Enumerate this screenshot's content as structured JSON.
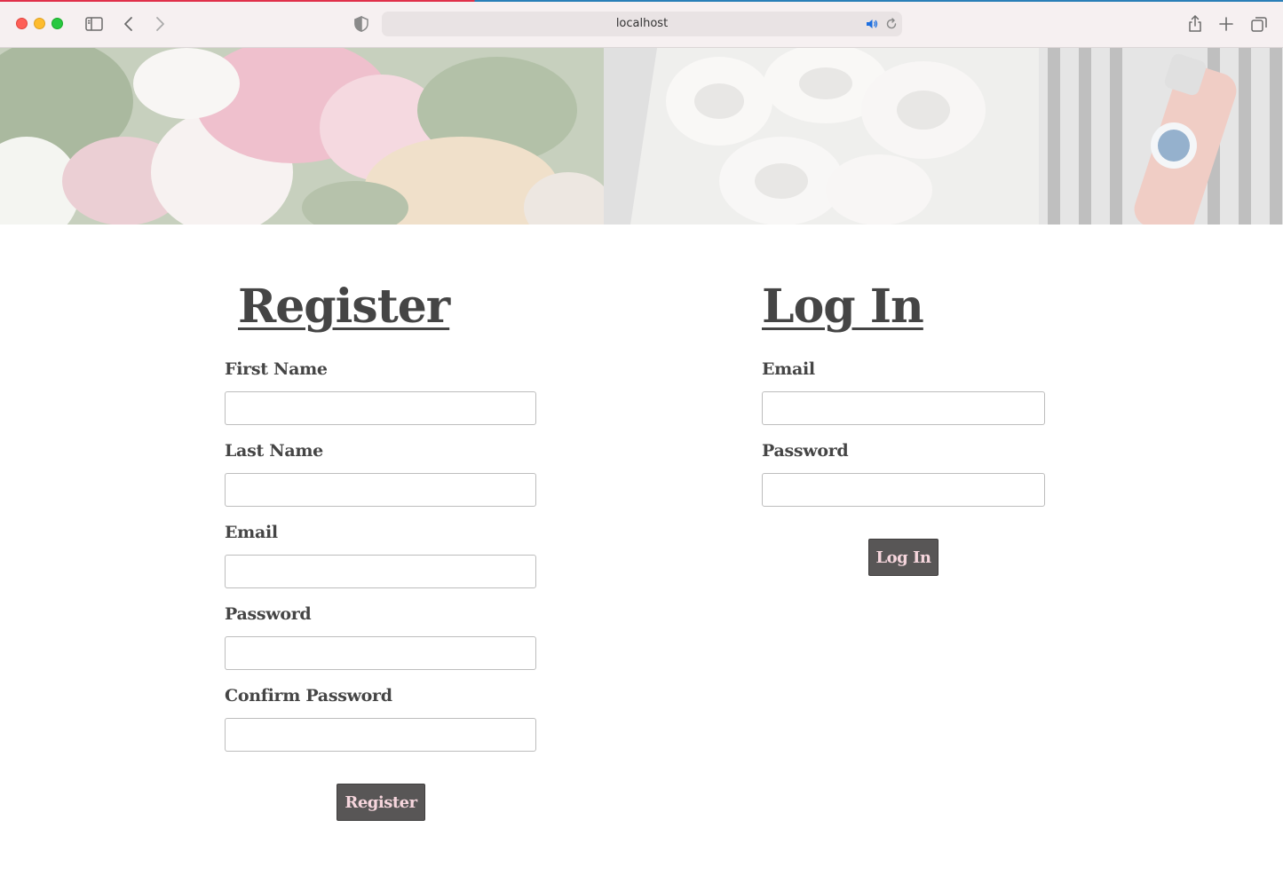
{
  "browser": {
    "url": "localhost",
    "icons": [
      "sidebar-icon",
      "back-icon",
      "forward-icon",
      "shield-icon",
      "speaker-icon",
      "reload-icon",
      "share-icon",
      "new-tab-icon",
      "tabs-overview-icon"
    ]
  },
  "register": {
    "heading": "Register",
    "fields": [
      {
        "label": "First Name",
        "value": ""
      },
      {
        "label": "Last Name",
        "value": ""
      },
      {
        "label": "Email",
        "value": ""
      },
      {
        "label": "Password",
        "value": ""
      },
      {
        "label": "Confirm Password",
        "value": ""
      }
    ],
    "button": "Register"
  },
  "login": {
    "heading": "Log In",
    "fields": [
      {
        "label": "Email",
        "value": ""
      },
      {
        "label": "Password",
        "value": ""
      }
    ],
    "button": "Log In"
  },
  "colors": {
    "text": "#454545",
    "button_bg": "#585656",
    "button_text": "#f6d6dd",
    "chrome_bg": "#f6f0f1"
  }
}
